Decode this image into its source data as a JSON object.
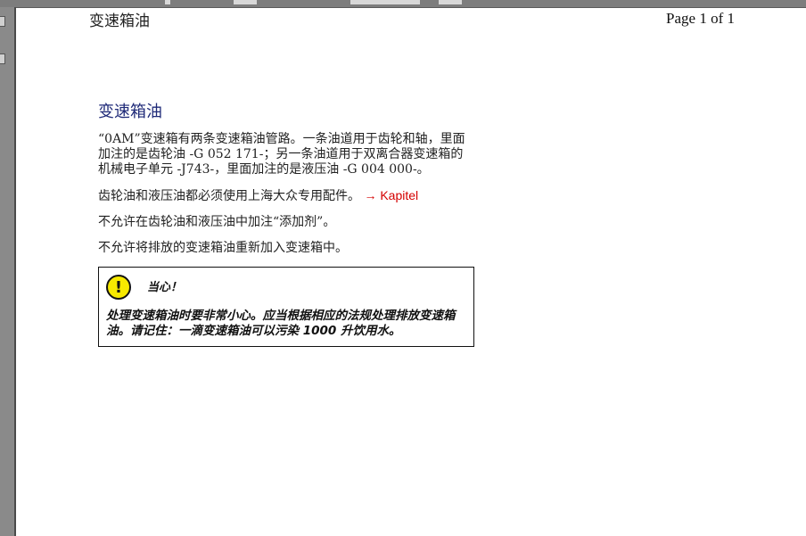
{
  "header": {
    "left_title": "变速箱油",
    "page_indicator": "Page 1 of 1"
  },
  "main": {
    "title": "变速箱油",
    "paragraphs": [
      "“0AM”变速箱有两条变速箱油管路。一条油道用于齿轮和轴，里面加注的是齿轮油 -G 052 171-；另一条油道用于双离合器变速箱的机械电子单元 -J743-，里面加注的是液压油 -G 004 000-。",
      "齿轮油和液压油都必须使用上海大众专用配件。",
      "不允许在齿轮油和液压油中加注“添加剂”。",
      "不允许将排放的变速箱油重新加入变速箱中。"
    ],
    "link_text": "→ Kapitel",
    "caution": {
      "icon": "exclamation-icon",
      "icon_symbol": "!",
      "label": "当心！",
      "text": "处理变速箱油时要非常小心。应当根据相应的法规处理排放变速箱油。请记住：一滴变速箱油可以污染 1000 升饮用水。"
    }
  },
  "colors": {
    "title": "#1f2a78",
    "link": "#d40000",
    "caution_icon_fill": "#f7e900"
  }
}
